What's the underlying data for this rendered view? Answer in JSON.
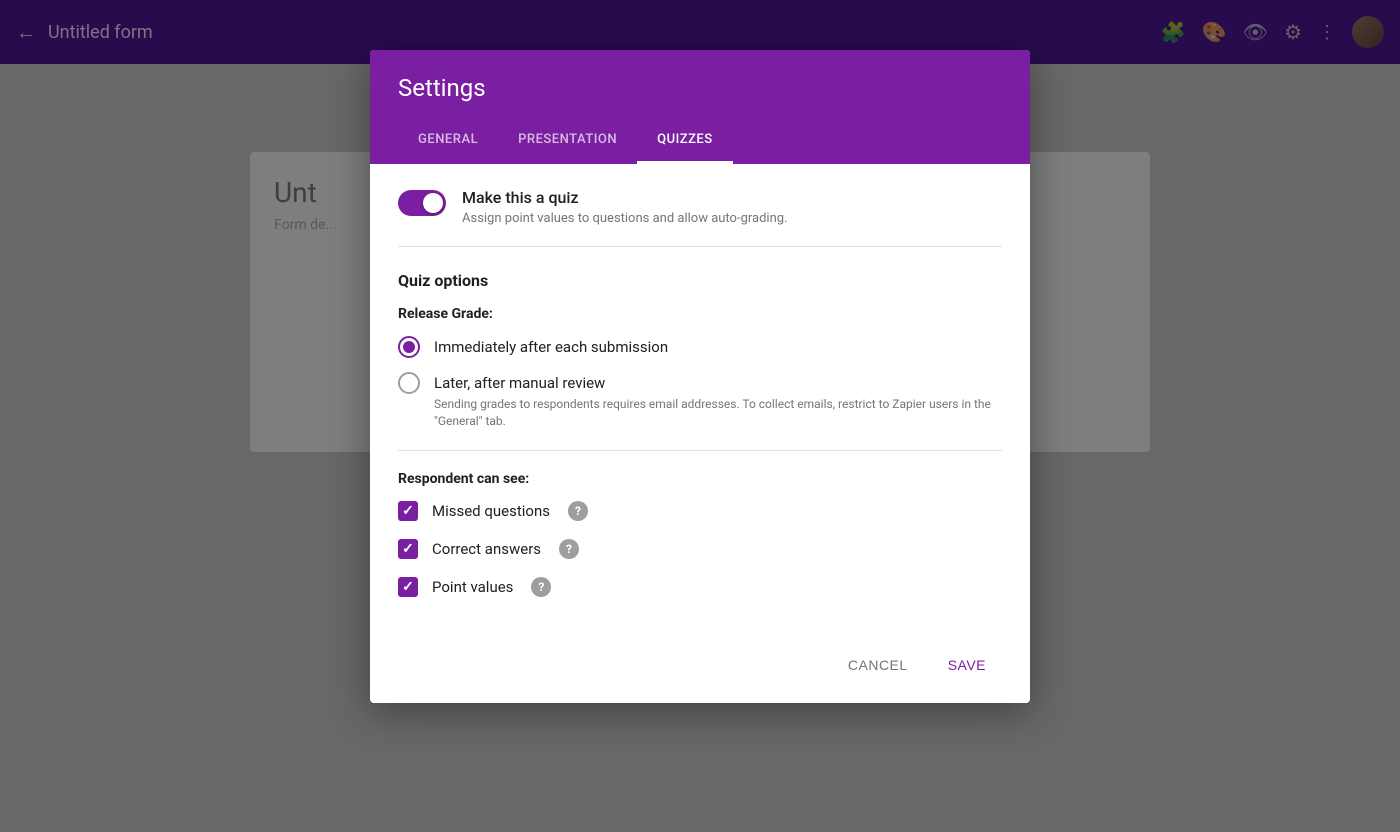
{
  "navbar": {
    "back_icon": "←",
    "title": "Untitled form",
    "icons": [
      "puzzle-icon",
      "palette-icon",
      "preview-icon",
      "settings-icon",
      "more-icon"
    ],
    "icon_symbols": [
      "🧩",
      "🎨",
      "👁",
      "⚙",
      "⋮"
    ]
  },
  "background": {
    "form_title": "Unt",
    "form_desc": "Form de..."
  },
  "dialog": {
    "title": "Settings",
    "tabs": [
      {
        "label": "GENERAL",
        "active": false
      },
      {
        "label": "PRESENTATION",
        "active": false
      },
      {
        "label": "QUIZZES",
        "active": true
      }
    ],
    "toggle": {
      "checked": true,
      "label": "Make this a quiz",
      "description": "Assign point values to questions and allow auto-grading."
    },
    "quiz_options_title": "Quiz options",
    "release_grade_label": "Release Grade:",
    "release_grade_options": [
      {
        "label": "Immediately after each submission",
        "sublabel": "",
        "selected": true
      },
      {
        "label": "Later, after manual review",
        "sublabel": "Sending grades to respondents requires email addresses. To collect emails, restrict to Zapier users in the \"General\" tab.",
        "selected": false
      }
    ],
    "respondent_label": "Respondent can see:",
    "respondent_options": [
      {
        "label": "Missed questions",
        "checked": true,
        "help": "?"
      },
      {
        "label": "Correct answers",
        "checked": true,
        "help": "?"
      },
      {
        "label": "Point values",
        "checked": true,
        "help": "?"
      }
    ],
    "footer": {
      "cancel_label": "CANCEL",
      "save_label": "SAVE"
    }
  }
}
